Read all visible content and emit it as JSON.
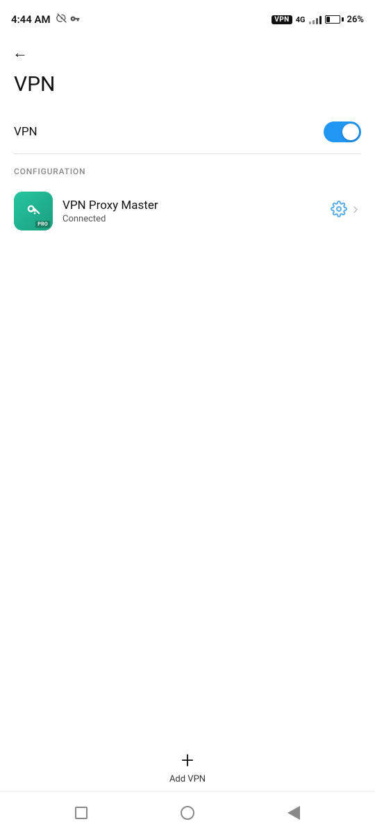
{
  "statusBar": {
    "time": "4:44 AM",
    "vpnBadge": "VPN",
    "networkType": "4G",
    "batteryPercent": "26%"
  },
  "backButton": {
    "arrowChar": "←"
  },
  "pageTitle": "VPN",
  "vpnToggle": {
    "label": "VPN",
    "enabled": true
  },
  "configuration": {
    "sectionLabel": "CONFIGURATION",
    "item": {
      "name": "VPN Proxy Master",
      "status": "Connected",
      "proBadge": "PRO"
    }
  },
  "addVpn": {
    "plusChar": "+",
    "label": "Add VPN"
  },
  "bottomNav": {
    "square": "",
    "circle": "",
    "triangle": ""
  }
}
